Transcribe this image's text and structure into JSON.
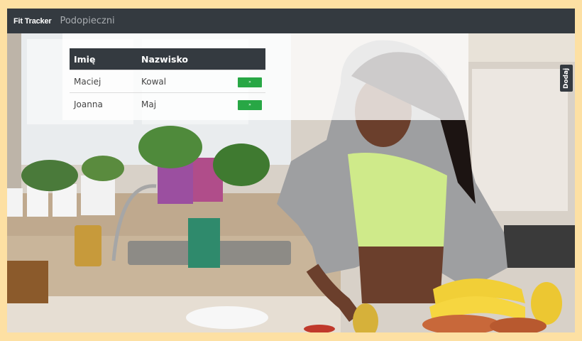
{
  "navbar": {
    "brand": "Fit Tracker",
    "link": "Podopieczni"
  },
  "table": {
    "headers": [
      "Imię",
      "Nazwisko"
    ],
    "rows": [
      {
        "first": "Maciej",
        "last": "Kowal",
        "action": "»"
      },
      {
        "first": "Joanna",
        "last": "Maj",
        "action": "»"
      }
    ]
  },
  "add_button": "Dodaj",
  "colors": {
    "navbar": "#343a40",
    "accent_green": "#28a745",
    "page_border": "#fde0a3"
  }
}
